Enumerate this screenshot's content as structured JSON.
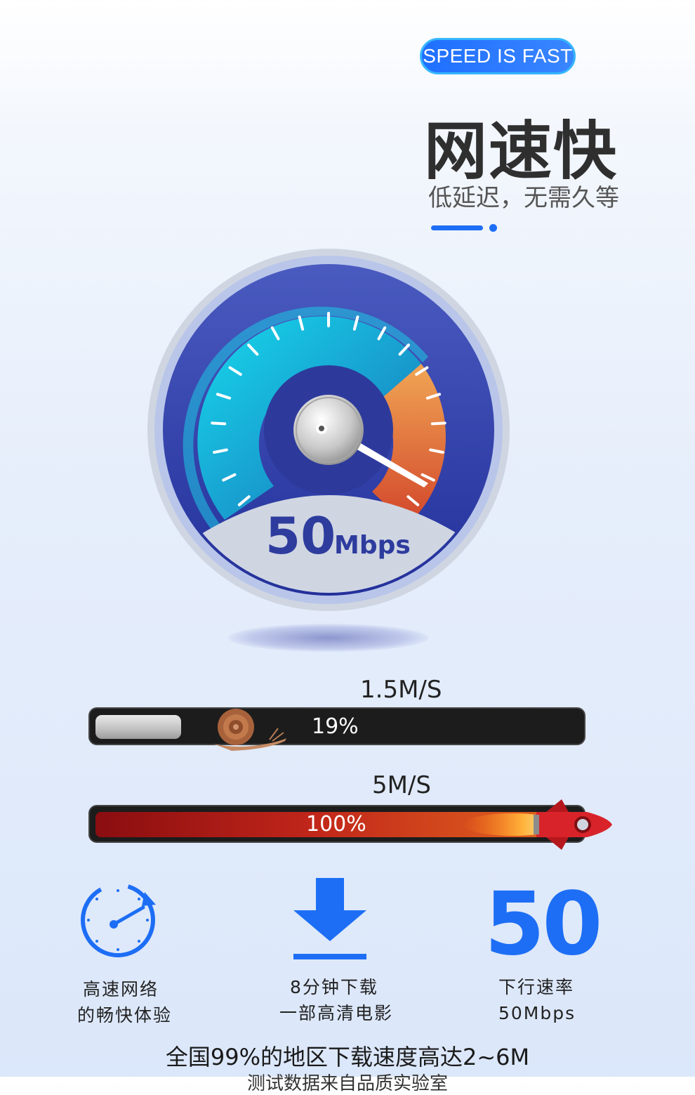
{
  "badge": "SPEED IS FAST",
  "headline": "网速快",
  "subline": "低延迟，无需久等",
  "gauge": {
    "value": "50",
    "unit": "Mbps"
  },
  "comparison": [
    {
      "speed_label": "1.5M/S",
      "percent_label": "19%",
      "progress": 0.19,
      "icon": "snail-icon"
    },
    {
      "speed_label": "5M/S",
      "percent_label": "100%",
      "progress": 1.0,
      "icon": "rocket-icon"
    }
  ],
  "features": [
    {
      "icon": "stopwatch-icon",
      "line1": "高速网络",
      "line2": "的畅快体验"
    },
    {
      "icon": "download-icon",
      "line1": "8分钟下载",
      "line2": "一部高清电影"
    },
    {
      "icon": "",
      "big": "50",
      "line1": "下行速率",
      "line2": "50Mbps"
    }
  ],
  "footer": "全国99%的地区下载速度高达2~6M",
  "footer_note": "测试数据来自品质实验室",
  "colors": {
    "accent": "#1d6ef5",
    "badge_border": "#37b6ff",
    "gauge_dark": "#2d3a9c",
    "gauge_cyan": "#1ec8e6",
    "gauge_orange": "#e8863a"
  }
}
